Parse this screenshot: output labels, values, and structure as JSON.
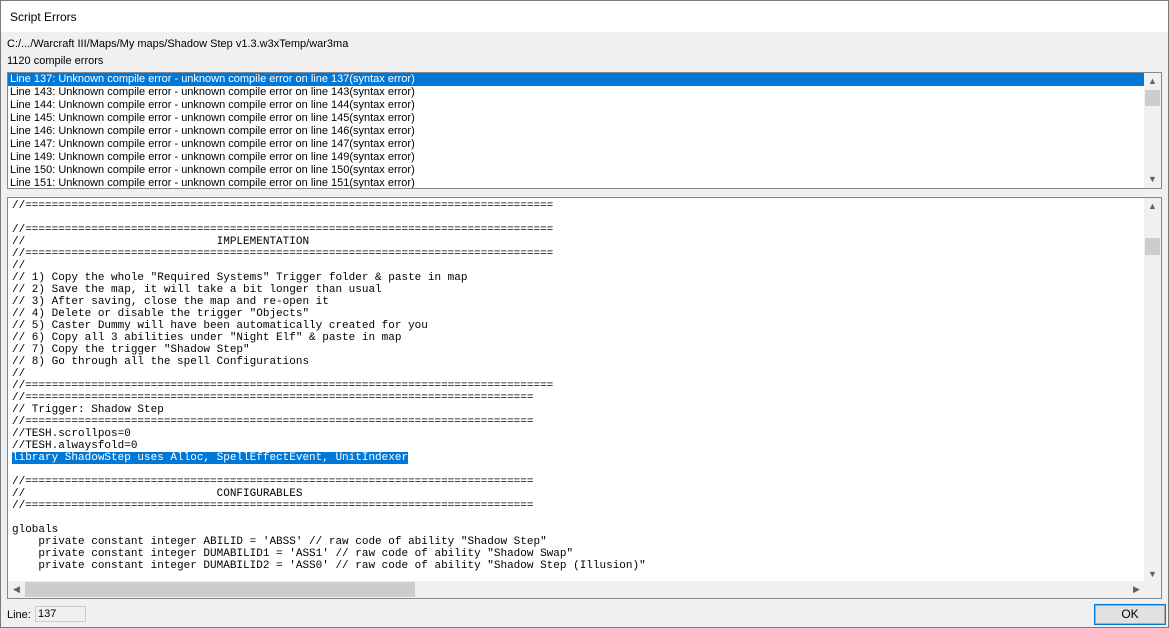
{
  "window": {
    "title": "Script Errors",
    "path": "C:/.../Warcraft III/Maps/My maps/Shadow Step v1.3.w3xTemp/war3ma",
    "error_count": "1120 compile errors"
  },
  "errors": [
    "Line 137: Unknown compile error - unknown compile error on line 137(syntax error)",
    "Line 143: Unknown compile error - unknown compile error on line 143(syntax error)",
    "Line 144: Unknown compile error - unknown compile error on line 144(syntax error)",
    "Line 145: Unknown compile error - unknown compile error on line 145(syntax error)",
    "Line 146: Unknown compile error - unknown compile error on line 146(syntax error)",
    "Line 147: Unknown compile error - unknown compile error on line 147(syntax error)",
    "Line 149: Unknown compile error - unknown compile error on line 149(syntax error)",
    "Line 150: Unknown compile error - unknown compile error on line 150(syntax error)",
    "Line 151: Unknown compile error - unknown compile error on line 151(syntax error)"
  ],
  "code_lines": [
    "//================================================================================",
    "",
    "//================================================================================",
    "//                             IMPLEMENTATION",
    "//================================================================================",
    "//",
    "// 1) Copy the whole \"Required Systems\" Trigger folder & paste in map",
    "// 2) Save the map, it will take a bit longer than usual",
    "// 3) After saving, close the map and re-open it",
    "// 4) Delete or disable the trigger \"Objects\"",
    "// 5) Caster Dummy will have been automatically created for you",
    "// 6) Copy all 3 abilities under \"Night Elf\" & paste in map",
    "// 7) Copy the trigger \"Shadow Step\"",
    "// 8) Go through all the spell Configurations",
    "//",
    "//================================================================================",
    "//=============================================================================",
    "// Trigger: Shadow Step",
    "//=============================================================================",
    "//TESH.scrollpos=0",
    "//TESH.alwaysfold=0",
    "library ShadowStep uses Alloc, SpellEffectEvent, UnitIndexer",
    "",
    "//=============================================================================",
    "//                             CONFIGURABLES",
    "//=============================================================================",
    "",
    "globals",
    "    private constant integer ABILID = 'ABSS' // raw code of ability \"Shadow Step\"",
    "    private constant integer DUMABILID1 = 'ASS1' // raw code of ability \"Shadow Swap\"",
    "    private constant integer DUMABILID2 = 'ASS0' // raw code of ability \"Shadow Step (Illusion)\""
  ],
  "highlighted_code_line": 21,
  "footer": {
    "line_label": "Line:",
    "line_value": "137",
    "ok_label": "OK"
  },
  "icons": {
    "scroll_up": "chevron-up-icon",
    "scroll_down": "chevron-down-icon",
    "scroll_left": "chevron-left-icon",
    "scroll_right": "chevron-right-icon"
  }
}
